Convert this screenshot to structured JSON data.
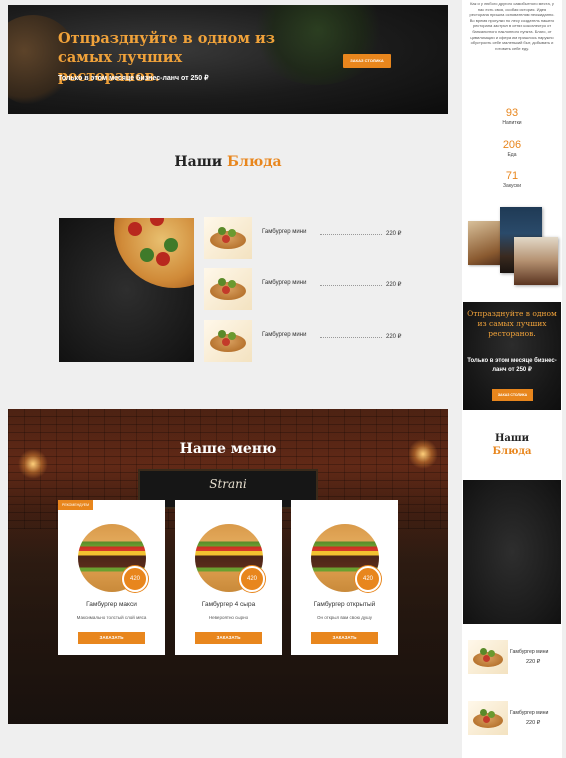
{
  "promo": {
    "title": "Отпразднуйте в одном из самых лучших ресторанов.",
    "subtitle": "Только в этом месяце бизнес-ланч от 250 ₽",
    "button": "Заказ столика"
  },
  "dishes": {
    "title_part1": "Наши",
    "title_part2": "Блюда",
    "items": [
      {
        "name": "Гамбургер мини",
        "price": "220 ₽"
      },
      {
        "name": "Гамбургер мини",
        "price": "220 ₽"
      },
      {
        "name": "Гамбургер мини",
        "price": "220 ₽"
      }
    ]
  },
  "our_menu": {
    "title": "Наше меню",
    "board_text": "Strani",
    "cards": [
      {
        "badge": "Рекомендуем",
        "price": "420",
        "title": "Гамбургер макси",
        "desc": "Максимально толстый слой мяса",
        "button": "Заказать"
      },
      {
        "badge": "",
        "price": "420",
        "title": "Гамбургер 4 сыра",
        "desc": "Невероятно сырно",
        "button": "Заказать"
      },
      {
        "badge": "",
        "price": "420",
        "title": "Гамбургер открытый",
        "desc": "Он открыл вам свою душу",
        "button": "Заказать"
      }
    ]
  },
  "sidebar": {
    "about": "Как и у любого другого самобытного места, у нас есть своя, особая история. Идея ресторана пришла основателям неожиданно. Во время прогулки по лесу создатель нашего ресторана застрял в сетях кокоэлектро от банкальтного наклонного пункта. Благо, от цивилизации и сфера им пришлось наружно обустроить себе маленький быт, добывать и готовить себе еду.",
    "stats": [
      {
        "number": "93",
        "label": "Напитки"
      },
      {
        "number": "206",
        "label": "Еда"
      },
      {
        "number": "71",
        "label": "Закуски"
      }
    ],
    "promo": {
      "title": "Отпразднуйте в одном из самых лучших ресторанов.",
      "subtitle": "Только в этом месяце бизнес-ланч от 250 ₽",
      "button": "Заказ столика"
    },
    "dishes_title_part1": "Наши",
    "dishes_title_part2": "Блюда",
    "items": [
      {
        "name": "Гамбургер мини",
        "price": "220 ₽"
      },
      {
        "name": "Гамбургер мини",
        "price": "220 ₽"
      }
    ]
  },
  "colors": {
    "accent": "#e8861d",
    "promo_title": "#f0a23a",
    "dark": "#1b1b1b"
  }
}
